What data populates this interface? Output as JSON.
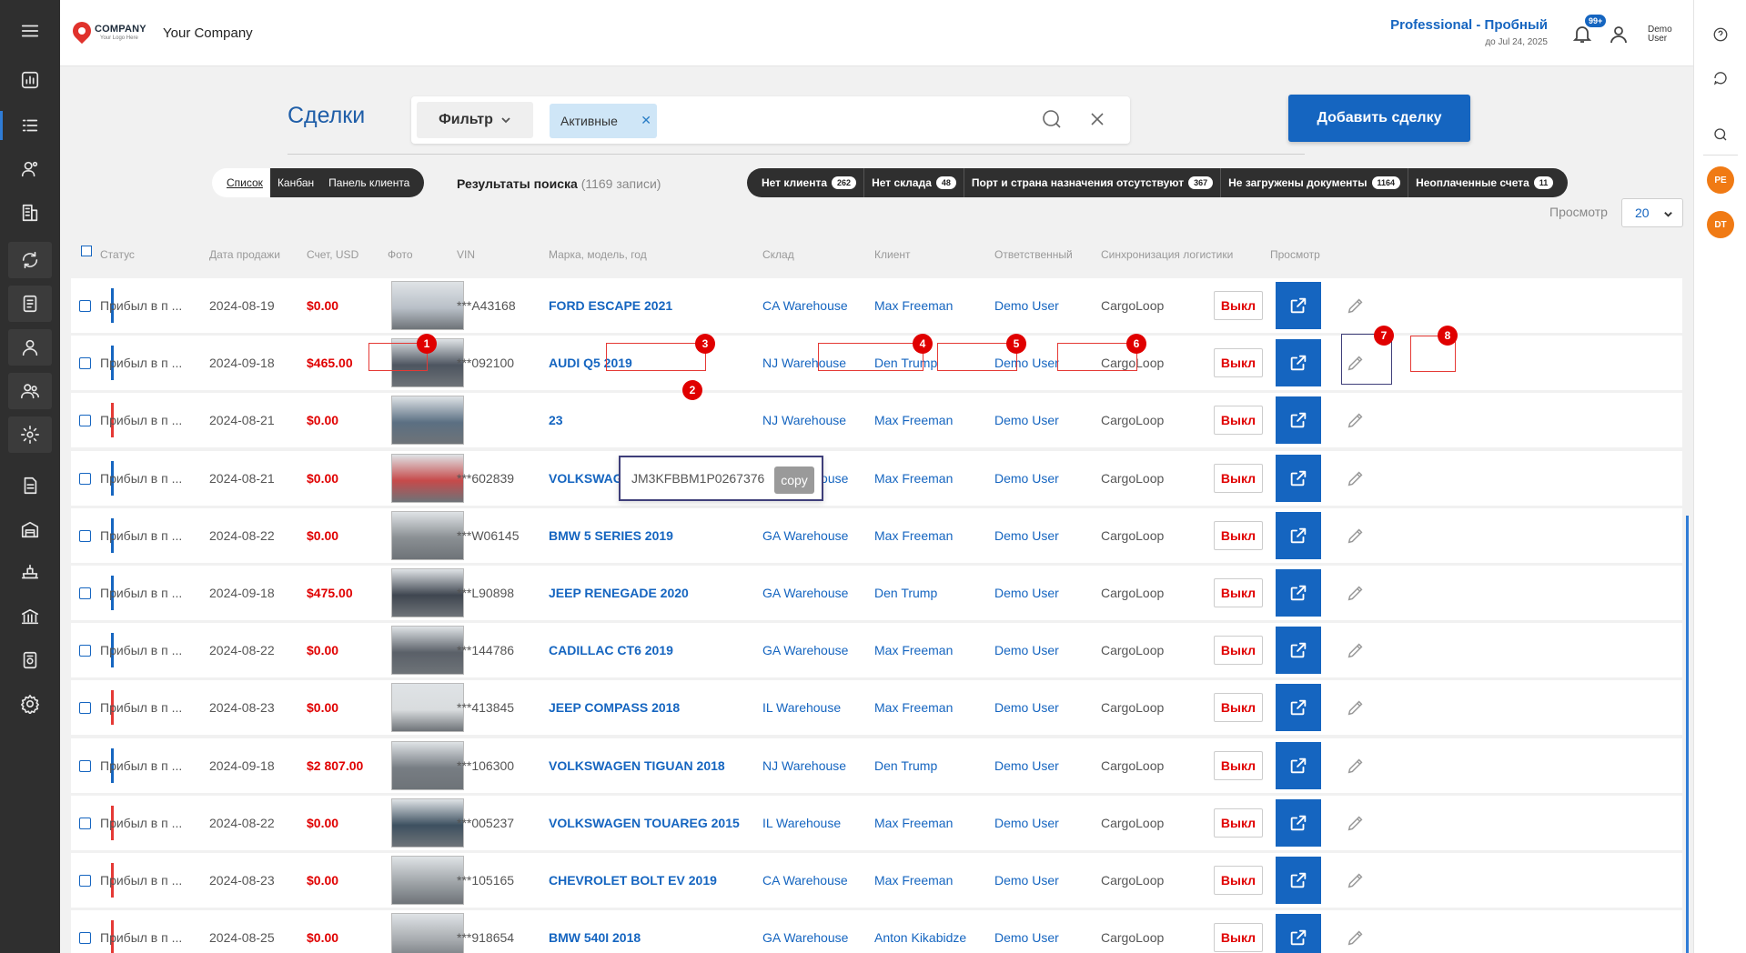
{
  "header": {
    "logo_word": "COMPANY",
    "logo_tagline": "Your Logo Here",
    "company_name": "Your Company",
    "plan_title": "Professional - Пробный",
    "plan_date": "до Jul 24, 2025",
    "notifications_badge": "99+",
    "user_name": "Demo User"
  },
  "sidebar": {
    "icons": [
      "menu-icon",
      "dashboard-icon",
      "deals-icon",
      "contacts-icon",
      "companies-icon",
      "sync-icon",
      "documents-icon",
      "user-icon",
      "users-icon",
      "settings-gear-icon",
      "invoice-icon",
      "warehouse-icon",
      "shipping-icon",
      "bank-icon",
      "reports-icon",
      "settings-icon"
    ],
    "active_index": 2
  },
  "rightbar": {
    "icons": [
      "help-icon",
      "chat-icon",
      "search-icon"
    ],
    "avatars": [
      "PE",
      "DT"
    ]
  },
  "page": {
    "title": "Сделки",
    "filter_label": "Фильтр",
    "active_chip": "Активные",
    "add_button": "Добавить сделку"
  },
  "views": [
    "Список",
    "Канбан",
    "Панель клиента"
  ],
  "results": {
    "label": "Результаты поиска",
    "count": "(1169 записи)"
  },
  "quick_filters": [
    {
      "label": "Нет клиента",
      "count": "262"
    },
    {
      "label": "Нет склада",
      "count": "48"
    },
    {
      "label": "Порт и страна назначения отсутствуют",
      "count": "367"
    },
    {
      "label": "Не загружены документы",
      "count": "1164"
    },
    {
      "label": "Неоплаченные счета",
      "count": "11"
    }
  ],
  "pager": {
    "label": "Просмотр",
    "value": "20"
  },
  "columns": [
    "Статус",
    "Дата продажи",
    "Счет, USD",
    "Фото",
    "VIN",
    "Марка, модель, год",
    "Склад",
    "Клиент",
    "Ответственный",
    "Синхронизация логистики",
    "Просмотр"
  ],
  "rows": [
    {
      "status": "Прибыл в п ...",
      "date": "2024-08-19",
      "amount": "$0.00",
      "vin": "***A43168",
      "model": "FORD ESCAPE 2021",
      "warehouse": "CA Warehouse",
      "client": "Max Freeman",
      "responsible": "Demo User",
      "sync": "CargoLoop",
      "toggle": "Выкл",
      "status_color": "#1565c0",
      "photo_color": "#b9c0c8"
    },
    {
      "status": "Прибыл в п ...",
      "date": "2024-09-18",
      "amount": "$465.00",
      "vin": "***092100",
      "model": "AUDI Q5 2019",
      "warehouse": "NJ Warehouse",
      "client": "Den Trump",
      "responsible": "Demo User",
      "sync": "CargoLoop",
      "toggle": "Выкл",
      "status_color": "#1565c0",
      "photo_color": "#4d5560"
    },
    {
      "status": "Прибыл в п ...",
      "date": "2024-08-21",
      "amount": "$0.00",
      "vin": "",
      "model": "23",
      "warehouse": "NJ Warehouse",
      "client": "Max Freeman",
      "responsible": "Demo User",
      "sync": "CargoLoop",
      "toggle": "Выкл",
      "status_color": "#e53935",
      "photo_color": "#5b6f82"
    },
    {
      "status": "Прибыл в п ...",
      "date": "2024-08-21",
      "amount": "$0.00",
      "vin": "***602839",
      "model": "VOLKSWAGEN BEETLE 2016",
      "warehouse": "GA Warehouse",
      "client": "Max Freeman",
      "responsible": "Demo User",
      "sync": "CargoLoop",
      "toggle": "Выкл",
      "status_color": "#1565c0",
      "photo_color": "#c64a4a"
    },
    {
      "status": "Прибыл в п ...",
      "date": "2024-08-22",
      "amount": "$0.00",
      "vin": "***W06145",
      "model": "BMW 5 SERIES 2019",
      "warehouse": "GA Warehouse",
      "client": "Max Freeman",
      "responsible": "Demo User",
      "sync": "CargoLoop",
      "toggle": "Выкл",
      "status_color": "#1565c0",
      "photo_color": "#8a8f93"
    },
    {
      "status": "Прибыл в п ...",
      "date": "2024-09-18",
      "amount": "$475.00",
      "vin": "***L90898",
      "model": "JEEP RENEGADE 2020",
      "warehouse": "GA Warehouse",
      "client": "Den Trump",
      "responsible": "Demo User",
      "sync": "CargoLoop",
      "toggle": "Выкл",
      "status_color": "#1565c0",
      "photo_color": "#3f4650"
    },
    {
      "status": "Прибыл в п ...",
      "date": "2024-08-22",
      "amount": "$0.00",
      "vin": "***144786",
      "model": "CADILLAC CT6 2019",
      "warehouse": "GA Warehouse",
      "client": "Max Freeman",
      "responsible": "Demo User",
      "sync": "CargoLoop",
      "toggle": "Выкл",
      "status_color": "#1565c0",
      "photo_color": "#5a6068"
    },
    {
      "status": "Прибыл в п ...",
      "date": "2024-08-23",
      "amount": "$0.00",
      "vin": "***413845",
      "model": "JEEP COMPASS 2018",
      "warehouse": "IL Warehouse",
      "client": "Max Freeman",
      "responsible": "Demo User",
      "sync": "CargoLoop",
      "toggle": "Выкл",
      "status_color": "#e53935",
      "photo_color": "#d9dcde"
    },
    {
      "status": "Прибыл в п ...",
      "date": "2024-09-18",
      "amount": "$2 807.00",
      "vin": "***106300",
      "model": "VOLKSWAGEN TIGUAN 2018",
      "warehouse": "NJ Warehouse",
      "client": "Den Trump",
      "responsible": "Demo User",
      "sync": "CargoLoop",
      "toggle": "Выкл",
      "status_color": "#1565c0",
      "photo_color": "#777d83"
    },
    {
      "status": "Прибыл в п ...",
      "date": "2024-08-22",
      "amount": "$0.00",
      "vin": "***005237",
      "model": "VOLKSWAGEN TOUAREG 2015",
      "warehouse": "IL Warehouse",
      "client": "Max Freeman",
      "responsible": "Demo User",
      "sync": "CargoLoop",
      "toggle": "Выкл",
      "status_color": "#e53935",
      "photo_color": "#3d5060"
    },
    {
      "status": "Прибыл в п ...",
      "date": "2024-08-23",
      "amount": "$0.00",
      "vin": "***105165",
      "model": "CHEVROLET BOLT EV 2019",
      "warehouse": "CA Warehouse",
      "client": "Max Freeman",
      "responsible": "Demo User",
      "sync": "CargoLoop",
      "toggle": "Выкл",
      "status_color": "#e53935",
      "photo_color": "#9fa4a8"
    },
    {
      "status": "Прибыл в п ...",
      "date": "2024-08-25",
      "amount": "$0.00",
      "vin": "***918654",
      "model": "BMW 540I 2018",
      "warehouse": "GA Warehouse",
      "client": "Anton Kikabidze",
      "responsible": "Demo User",
      "sync": "CargoLoop",
      "toggle": "Выкл",
      "status_color": "#e53935",
      "photo_color": "#a7abaf"
    }
  ],
  "vin_popup": {
    "full_vin": "JM3KFBBM1P0267376",
    "copy_label": "copy"
  },
  "callouts": [
    "1",
    "2",
    "3",
    "4",
    "5",
    "6",
    "7",
    "8"
  ]
}
